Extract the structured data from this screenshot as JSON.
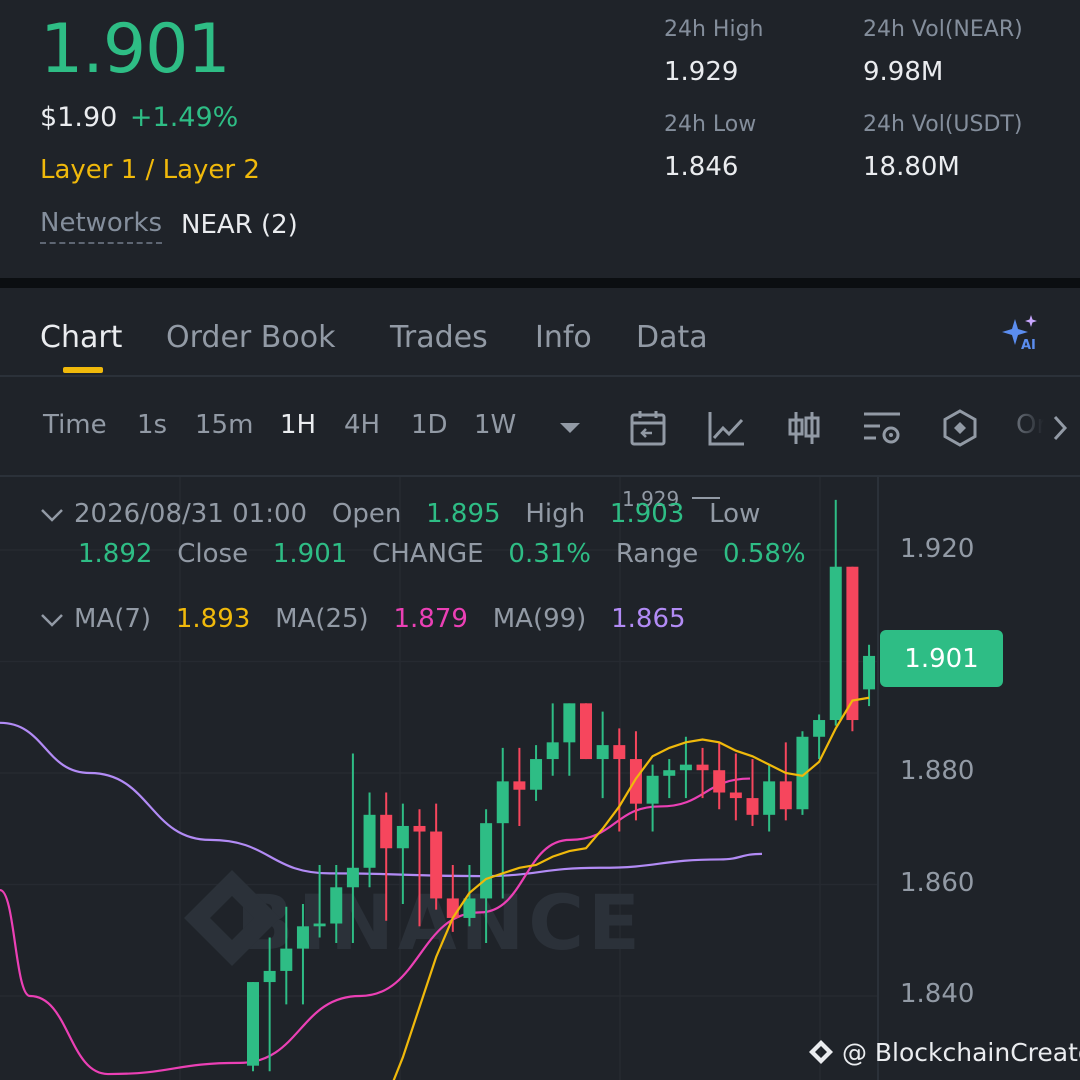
{
  "header": {
    "last_price": "1.901",
    "usd_price": "$1.90",
    "change_pct": "+1.49%",
    "category": "Layer 1 / Layer 2",
    "networks_label": "Networks",
    "networks_value": "NEAR (2)",
    "stats": {
      "high_label": "24h High",
      "high_value": "1.929",
      "low_label": "24h Low",
      "low_value": "1.846",
      "vol_base_label": "24h Vol(NEAR)",
      "vol_base_value": "9.98M",
      "vol_quote_label": "24h Vol(USDT)",
      "vol_quote_value": "18.80M"
    }
  },
  "tabs": [
    "Chart",
    "Order Book",
    "Trades",
    "Info",
    "Data"
  ],
  "active_tab": "Chart",
  "timeframes": [
    "Time",
    "1s",
    "15m",
    "1H",
    "4H",
    "1D",
    "1W"
  ],
  "active_timeframe": "1H",
  "toolbar_icons": [
    "chevron-down-icon",
    "calendar-icon",
    "indicator-icon",
    "depth-icon",
    "settings-icon",
    "hexagon-icon",
    "chevron-right-icon"
  ],
  "toolbar_overflow": "Or",
  "ohlc": {
    "datetime": "2026/08/31 01:00",
    "open_label": "Open",
    "open": "1.895",
    "high_label": "High",
    "high": "1.903",
    "low_label": "Low",
    "low": "1.892",
    "close_label": "Close",
    "close": "1.901",
    "change_label": "CHANGE",
    "change": "0.31%",
    "range_label": "Range",
    "range": "0.58%"
  },
  "ma": {
    "ma7_label": "MA(7)",
    "ma7": "1.893",
    "ma25_label": "MA(25)",
    "ma25": "1.879",
    "ma99_label": "MA(99)",
    "ma99": "1.865"
  },
  "axis": {
    "ticks": [
      "1.920",
      "1.880",
      "1.860",
      "1.840"
    ],
    "current_price": "1.901",
    "high_marker": "1.929"
  },
  "watermark": "BINANCE",
  "credit": "@ BlockchainCreator",
  "colors": {
    "up": "#2ebd85",
    "down": "#f6465d",
    "accent": "#f0b90b",
    "ma7": "#f0b90b",
    "ma25": "#eb40b5",
    "ma99": "#b28bf5"
  },
  "chart_data": {
    "type": "candlestick",
    "ylim": [
      1.8265,
      1.9325
    ],
    "candles": [
      {
        "o": 1.8275,
        "h": 1.8425,
        "l": 1.8265,
        "c": 1.8425
      },
      {
        "o": 1.8425,
        "h": 1.8505,
        "l": 1.8265,
        "c": 1.8445
      },
      {
        "o": 1.8445,
        "h": 1.856,
        "l": 1.8385,
        "c": 1.8485
      },
      {
        "o": 1.8485,
        "h": 1.8565,
        "l": 1.8385,
        "c": 1.8525
      },
      {
        "o": 1.8525,
        "h": 1.8635,
        "l": 1.8505,
        "c": 1.853
      },
      {
        "o": 1.853,
        "h": 1.8635,
        "l": 1.8495,
        "c": 1.8595
      },
      {
        "o": 1.8595,
        "h": 1.8835,
        "l": 1.8495,
        "c": 1.863
      },
      {
        "o": 1.863,
        "h": 1.8765,
        "l": 1.8595,
        "c": 1.8725
      },
      {
        "o": 1.8725,
        "h": 1.8765,
        "l": 1.8535,
        "c": 1.8665
      },
      {
        "o": 1.8665,
        "h": 1.8745,
        "l": 1.8565,
        "c": 1.8705
      },
      {
        "o": 1.8705,
        "h": 1.8735,
        "l": 1.8525,
        "c": 1.8695
      },
      {
        "o": 1.8695,
        "h": 1.8745,
        "l": 1.8555,
        "c": 1.8575
      },
      {
        "o": 1.8575,
        "h": 1.8635,
        "l": 1.8515,
        "c": 1.854
      },
      {
        "o": 1.854,
        "h": 1.8635,
        "l": 1.8525,
        "c": 1.8575
      },
      {
        "o": 1.8575,
        "h": 1.8735,
        "l": 1.8495,
        "c": 1.871
      },
      {
        "o": 1.871,
        "h": 1.8845,
        "l": 1.8575,
        "c": 1.8785
      },
      {
        "o": 1.8785,
        "h": 1.8845,
        "l": 1.8705,
        "c": 1.877
      },
      {
        "o": 1.877,
        "h": 1.885,
        "l": 1.875,
        "c": 1.8825
      },
      {
        "o": 1.8825,
        "h": 1.8925,
        "l": 1.8795,
        "c": 1.8855
      },
      {
        "o": 1.8855,
        "h": 1.8925,
        "l": 1.8795,
        "c": 1.8925
      },
      {
        "o": 1.8925,
        "h": 1.8925,
        "l": 1.8825,
        "c": 1.8825
      },
      {
        "o": 1.8825,
        "h": 1.891,
        "l": 1.8755,
        "c": 1.885
      },
      {
        "o": 1.885,
        "h": 1.888,
        "l": 1.8695,
        "c": 1.8825
      },
      {
        "o": 1.8825,
        "h": 1.8875,
        "l": 1.8715,
        "c": 1.8745
      },
      {
        "o": 1.8745,
        "h": 1.8815,
        "l": 1.8695,
        "c": 1.8795
      },
      {
        "o": 1.8795,
        "h": 1.8825,
        "l": 1.8755,
        "c": 1.8805
      },
      {
        "o": 1.8805,
        "h": 1.8865,
        "l": 1.8755,
        "c": 1.8815
      },
      {
        "o": 1.8815,
        "h": 1.8845,
        "l": 1.8755,
        "c": 1.8805
      },
      {
        "o": 1.8805,
        "h": 1.8855,
        "l": 1.8735,
        "c": 1.8765
      },
      {
        "o": 1.8765,
        "h": 1.8835,
        "l": 1.8715,
        "c": 1.8755
      },
      {
        "o": 1.8755,
        "h": 1.8825,
        "l": 1.8705,
        "c": 1.8725
      },
      {
        "o": 1.8725,
        "h": 1.8815,
        "l": 1.8695,
        "c": 1.8785
      },
      {
        "o": 1.8785,
        "h": 1.8855,
        "l": 1.8715,
        "c": 1.8735
      },
      {
        "o": 1.8735,
        "h": 1.8875,
        "l": 1.8725,
        "c": 1.8865
      },
      {
        "o": 1.8865,
        "h": 1.8905,
        "l": 1.8825,
        "c": 1.8895
      },
      {
        "o": 1.8895,
        "h": 1.929,
        "l": 1.8885,
        "c": 1.917
      },
      {
        "o": 1.917,
        "h": 1.917,
        "l": 1.8875,
        "c": 1.8895
      },
      {
        "o": 1.895,
        "h": 1.903,
        "l": 1.892,
        "c": 1.901
      }
    ],
    "ma7": [
      1.8215,
      1.829,
      1.838,
      1.847,
      1.854,
      1.8585,
      1.861,
      1.862,
      1.863,
      1.8635,
      1.865,
      1.866,
      1.8665,
      1.87,
      1.874,
      1.879,
      1.883,
      1.8845,
      1.8855,
      1.886,
      1.8855,
      1.884,
      1.883,
      1.8815,
      1.88,
      1.8795,
      1.882,
      1.888,
      1.893,
      1.8935
    ],
    "ma25_anchor": [
      [
        0,
        1.859
      ],
      [
        5,
        1.84
      ],
      [
        18,
        1.826
      ],
      [
        40,
        1.828
      ],
      [
        60,
        1.84
      ],
      [
        80,
        1.855
      ],
      [
        95,
        1.868
      ],
      [
        110,
        1.874
      ],
      [
        125,
        1.879
      ]
    ],
    "ma99_anchor": [
      [
        0,
        1.889
      ],
      [
        15,
        1.88
      ],
      [
        35,
        1.868
      ],
      [
        55,
        1.862
      ],
      [
        80,
        1.8615
      ],
      [
        100,
        1.863
      ],
      [
        120,
        1.8645
      ],
      [
        127,
        1.8655
      ]
    ]
  }
}
